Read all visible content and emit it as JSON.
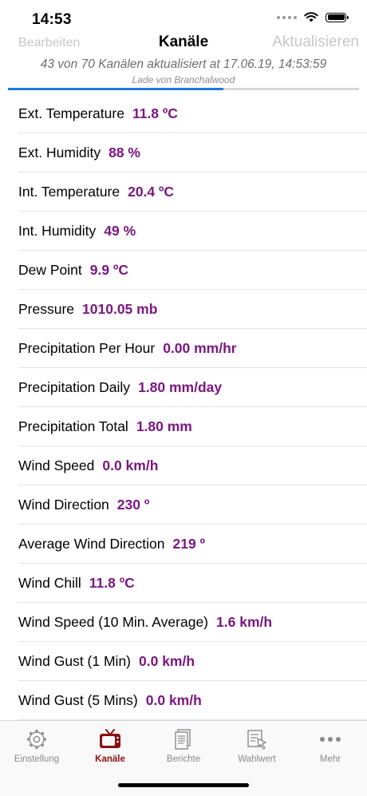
{
  "status_bar": {
    "time": "14:53"
  },
  "nav": {
    "left_button": "Bearbeiten",
    "title": "Kanäle",
    "right_button": "Aktualisieren",
    "subtitle": "43 von 70 Kanälen aktualisiert at 17.06.19, 14:53:59",
    "loading": "Lade von Branchalwood",
    "progress_fraction": 0.614
  },
  "channels": [
    {
      "label": "Ext. Temperature",
      "value": "11.8 ºC"
    },
    {
      "label": "Ext. Humidity",
      "value": "88 %"
    },
    {
      "label": "Int. Temperature",
      "value": "20.4 ºC"
    },
    {
      "label": "Int. Humidity",
      "value": "49 %"
    },
    {
      "label": "Dew Point",
      "value": "9.9 ºC"
    },
    {
      "label": "Pressure",
      "value": "1010.05 mb"
    },
    {
      "label": "Precipitation Per Hour",
      "value": "0.00 mm/hr"
    },
    {
      "label": "Precipitation Daily",
      "value": "1.80 mm/day"
    },
    {
      "label": "Precipitation Total",
      "value": "1.80 mm"
    },
    {
      "label": "Wind Speed",
      "value": "0.0 km/h"
    },
    {
      "label": "Wind Direction",
      "value": "230 º"
    },
    {
      "label": "Average Wind Direction",
      "value": "219 º"
    },
    {
      "label": "Wind Chill",
      "value": "11.8 ºC"
    },
    {
      "label": "Wind Speed (10 Min. Average)",
      "value": "1.6 km/h"
    },
    {
      "label": "Wind Gust (1 Min)",
      "value": "0.0 km/h"
    },
    {
      "label": "Wind Gust (5 Mins)",
      "value": "0.0 km/h"
    }
  ],
  "tabs": [
    {
      "label": "Einstellung",
      "icon": "gear-icon",
      "active": false
    },
    {
      "label": "Kanäle",
      "icon": "tv-icon",
      "active": true
    },
    {
      "label": "Berichte",
      "icon": "documents-icon",
      "active": false
    },
    {
      "label": "Wahlwert",
      "icon": "select-value-icon",
      "active": false
    },
    {
      "label": "Mehr",
      "icon": "more-icon",
      "active": false
    }
  ],
  "colors": {
    "value_text": "#7b1782",
    "active_tab": "#8b1010",
    "progress": "#1f7ad6",
    "disabled_button": "#c7c7cc"
  }
}
